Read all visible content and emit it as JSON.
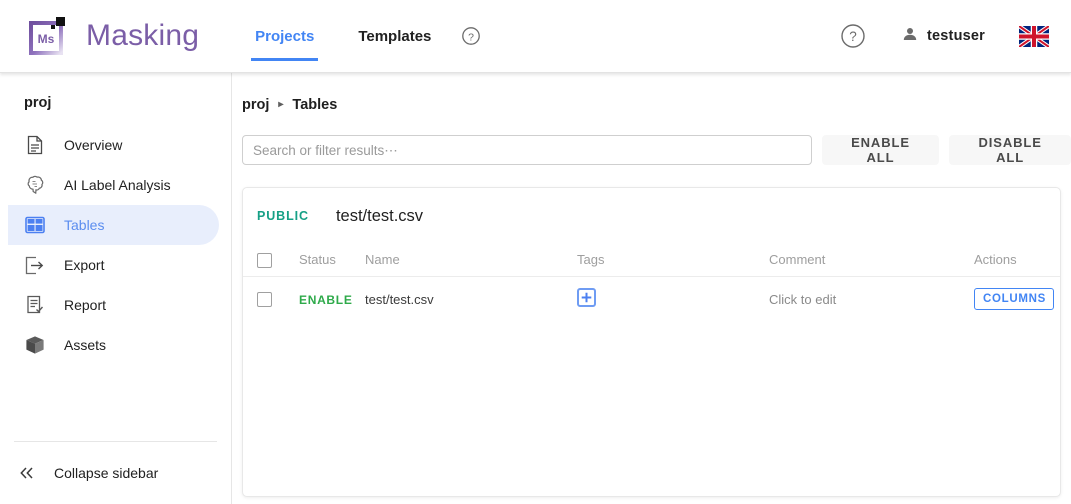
{
  "header": {
    "brand": {
      "logo_text": "Ms",
      "name": "Masking",
      "logo_icon": "masking-logo-icon"
    },
    "nav": [
      {
        "label": "Projects",
        "active": true
      },
      {
        "label": "Templates",
        "active": false
      }
    ],
    "nav_help_icon": "help-circle-icon",
    "right": {
      "help_icon": "help-circle-icon",
      "user_icon": "person-icon",
      "user_name": "testuser",
      "language_flag": "uk-flag-icon"
    }
  },
  "sidebar": {
    "project_name": "proj",
    "items": [
      {
        "label": "Overview",
        "icon": "document-icon",
        "active": false
      },
      {
        "label": "AI Label Analysis",
        "icon": "brain-icon",
        "active": false
      },
      {
        "label": "Tables",
        "icon": "table-grid-icon",
        "active": true
      },
      {
        "label": "Export",
        "icon": "export-arrow-icon",
        "active": false
      },
      {
        "label": "Report",
        "icon": "report-check-icon",
        "active": false
      },
      {
        "label": "Assets",
        "icon": "box-icon",
        "active": false
      }
    ],
    "collapse": {
      "label": "Collapse sidebar",
      "icon": "double-chevron-left-icon"
    }
  },
  "main": {
    "breadcrumb": {
      "root": "proj",
      "separator": "▸",
      "current": "Tables"
    },
    "search": {
      "value": "",
      "placeholder": "Search or filter results⋯"
    },
    "buttons": {
      "enable_all": "ENABLE ALL",
      "disable_all": "DISABLE ALL"
    },
    "card": {
      "badge": "PUBLIC",
      "title": "test/test.csv",
      "columns": [
        "Status",
        "Name",
        "Tags",
        "Comment",
        "Actions"
      ],
      "rows": [
        {
          "checked": false,
          "status": "ENABLE",
          "name": "test/test.csv",
          "tags_icon": "add-tag-plus-icon",
          "comment": "Click to edit",
          "action_label": "COLUMNS"
        }
      ]
    }
  },
  "colors": {
    "brand_purple": "#7b5ea7",
    "accent_blue": "#4285f4",
    "sidebar_active_bg": "#e8eefc",
    "sidebar_active_text": "#5b8def",
    "public_teal": "#16a086",
    "enable_green": "#2eaa4a"
  }
}
